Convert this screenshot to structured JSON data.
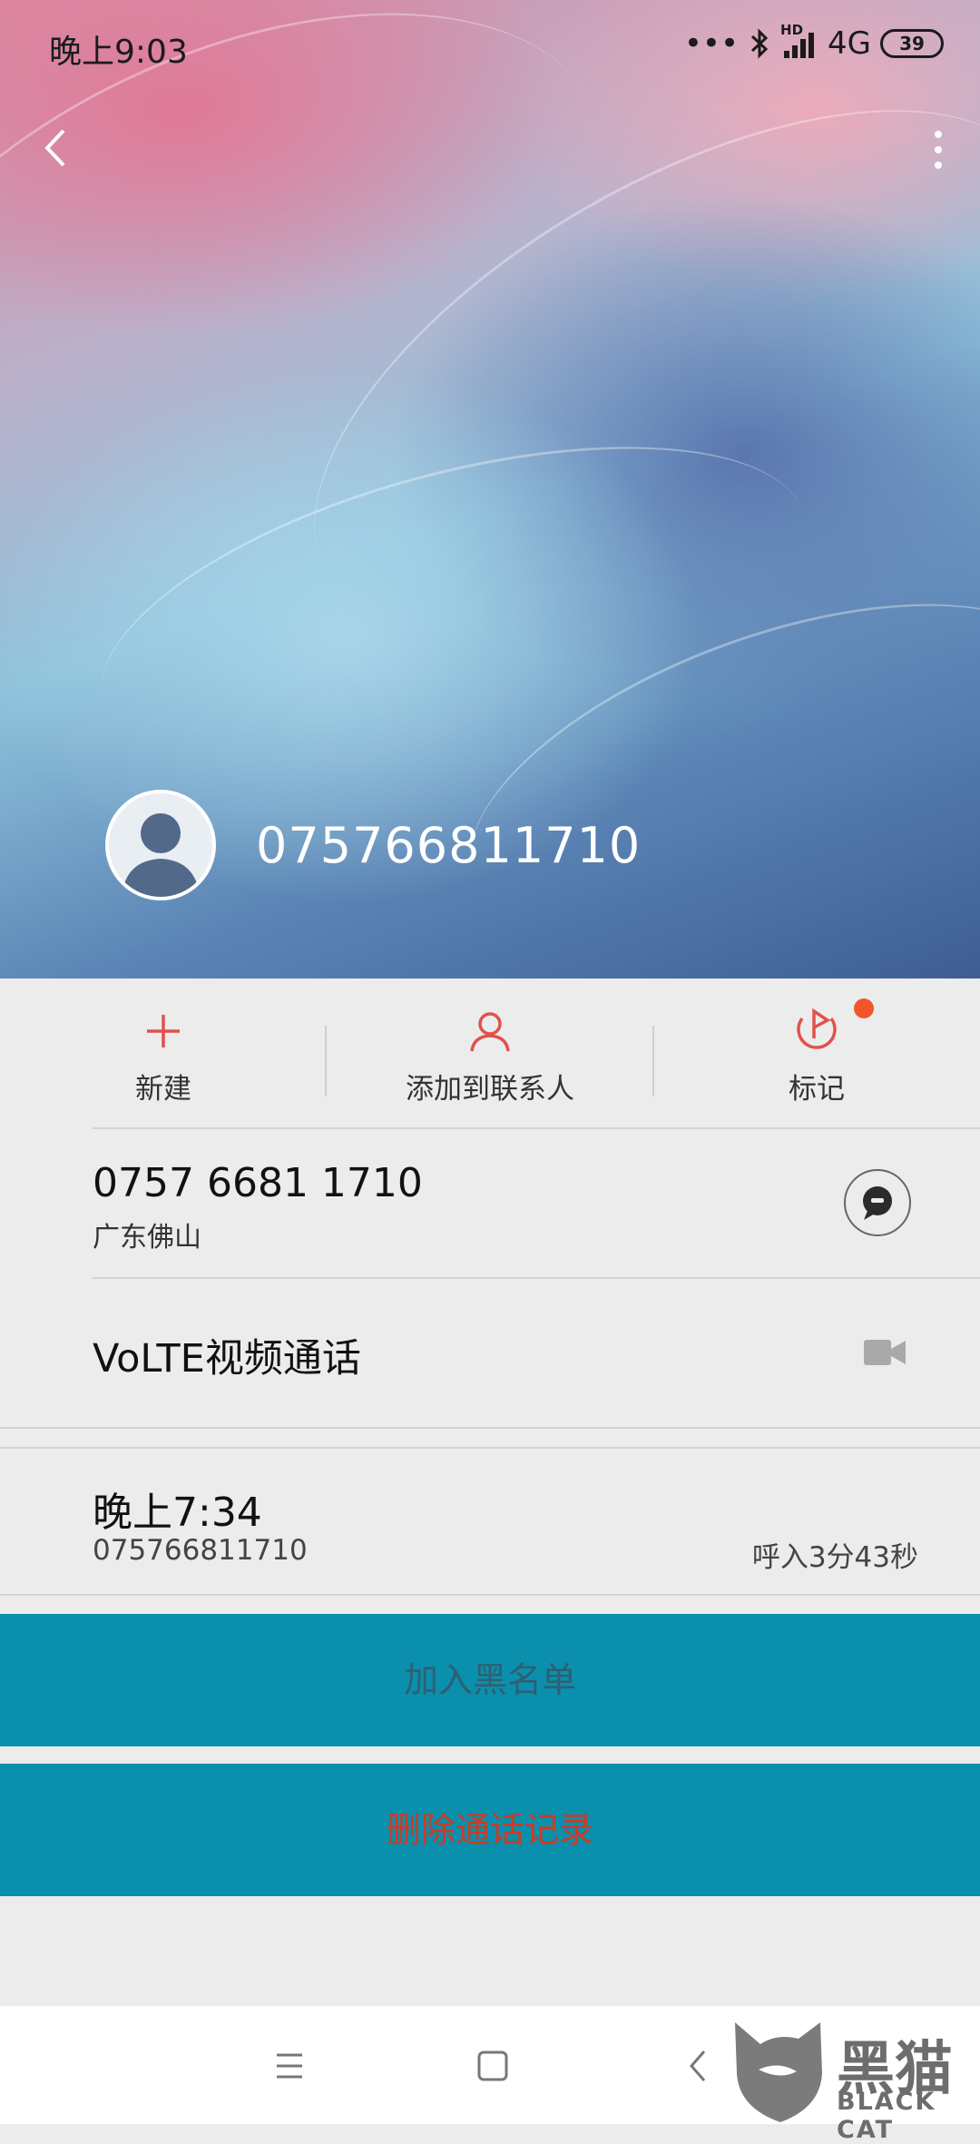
{
  "status_bar": {
    "time": "晚上9:03",
    "network": "4G",
    "battery": "39",
    "hd_label": "HD"
  },
  "header": {
    "number": "075766811710"
  },
  "actions": [
    {
      "label": "新建",
      "icon": "plus-icon"
    },
    {
      "label": "添加到联系人",
      "icon": "person-icon"
    },
    {
      "label": "标记",
      "icon": "flag-icon",
      "badge": "new"
    }
  ],
  "number_row": {
    "number": "0757 6681 1710",
    "location": "广东佛山",
    "icon": "message-icon"
  },
  "volte_row": {
    "label": "VoLTE视频通话",
    "icon": "video-camera-icon"
  },
  "call_log": {
    "time": "晚上7:34",
    "number": "075766811710",
    "type": "呼入3分43秒"
  },
  "buttons": {
    "block": "加入黑名单",
    "delete": "删除通话记录"
  },
  "navbar": {
    "items": [
      "menu-icon",
      "home-icon",
      "back-icon"
    ]
  },
  "watermark": {
    "cn": "黑猫",
    "en": "BLACK CAT"
  },
  "colors": {
    "accent": "#e0524a",
    "button_bg": "#0a8fad",
    "delete_text": "#cc3b24",
    "badge": "#f1562b"
  }
}
